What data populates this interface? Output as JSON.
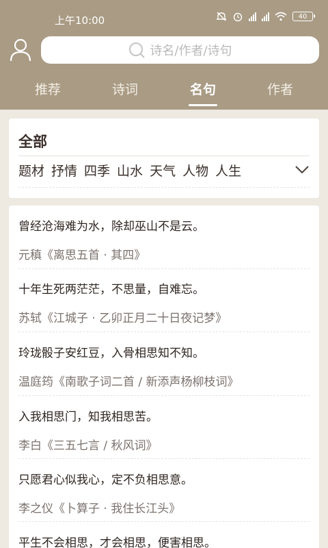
{
  "status": {
    "time": "上午10:00",
    "battery": "40"
  },
  "search": {
    "placeholder": "诗名/作者/诗句"
  },
  "tabs": [
    {
      "label": "推荐",
      "active": false
    },
    {
      "label": "诗词",
      "active": false
    },
    {
      "label": "名句",
      "active": true
    },
    {
      "label": "作者",
      "active": false
    }
  ],
  "filter": {
    "title": "全部",
    "category_label": "题材",
    "options": [
      "抒情",
      "四季",
      "山水",
      "天气",
      "人物",
      "人生"
    ]
  },
  "quotes": [
    {
      "text": "曾经沧海难为水，除却巫山不是云。",
      "source": "元稹《离思五首 · 其四》"
    },
    {
      "text": "十年生死两茫茫，不思量，自难忘。",
      "source": "苏轼《江城子 · 乙卯正月二十日夜记梦》"
    },
    {
      "text": "玲珑骰子安红豆，入骨相思知不知。",
      "source": "温庭筠《南歌子词二首 / 新添声杨柳枝词》"
    },
    {
      "text": "入我相思门，知我相思苦。",
      "source": "李白《三五七言 / 秋风词》"
    },
    {
      "text": "只愿君心似我心，定不负相思意。",
      "source": "李之仪《卜算子 · 我住长江头》"
    },
    {
      "text": "平生不会相思，才会相思，便害相思。",
      "source": ""
    }
  ],
  "colors": {
    "header": "#a99b84",
    "background": "#eee9e1",
    "text": "#2f2622",
    "source": "#7b726d"
  }
}
